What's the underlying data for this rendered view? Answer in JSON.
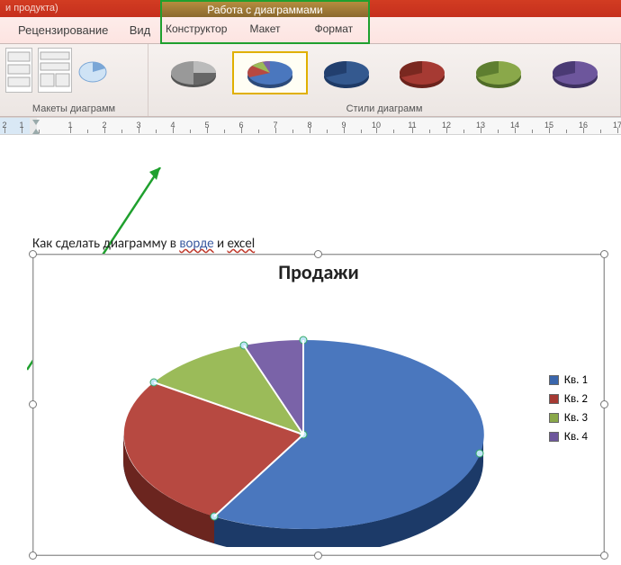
{
  "titlebar": {
    "product_hint": "и продукта)"
  },
  "context_group_title": "Работа с диаграммами",
  "tabs": {
    "review": "Рецензирование",
    "view": "Вид"
  },
  "context_tabs": {
    "design": "Конструктор",
    "layout": "Макет",
    "format": "Формат"
  },
  "ribbon_groups": {
    "layouts": "Макеты диаграмм",
    "styles": "Стили диаграмм"
  },
  "ruler_numbers": [
    "2",
    "1",
    "1",
    "2",
    "3",
    "4",
    "5",
    "6",
    "7",
    "8",
    "9",
    "10",
    "11",
    "12",
    "13",
    "14",
    "15",
    "16",
    "17"
  ],
  "caption_parts": {
    "p1": "Как сделать диаграмму в ",
    "word": "ворде",
    "p2": " и ",
    "excel": "excel"
  },
  "chart_title": "Продажи",
  "legend": [
    {
      "label": "Кв. 1",
      "color": "#3a66ac"
    },
    {
      "label": "Кв. 2",
      "color": "#a63a33"
    },
    {
      "label": "Кв. 3",
      "color": "#8aa84a"
    },
    {
      "label": "Кв. 4",
      "color": "#6d569c"
    }
  ],
  "chart_data": {
    "type": "pie",
    "title": "Продажи",
    "categories": [
      "Кв. 1",
      "Кв. 2",
      "Кв. 3",
      "Кв. 4"
    ],
    "values": [
      58,
      23,
      10,
      9
    ],
    "colors": [
      "#4a77be",
      "#b74941",
      "#9bbb59",
      "#7a63a8"
    ],
    "legend_position": "right"
  }
}
